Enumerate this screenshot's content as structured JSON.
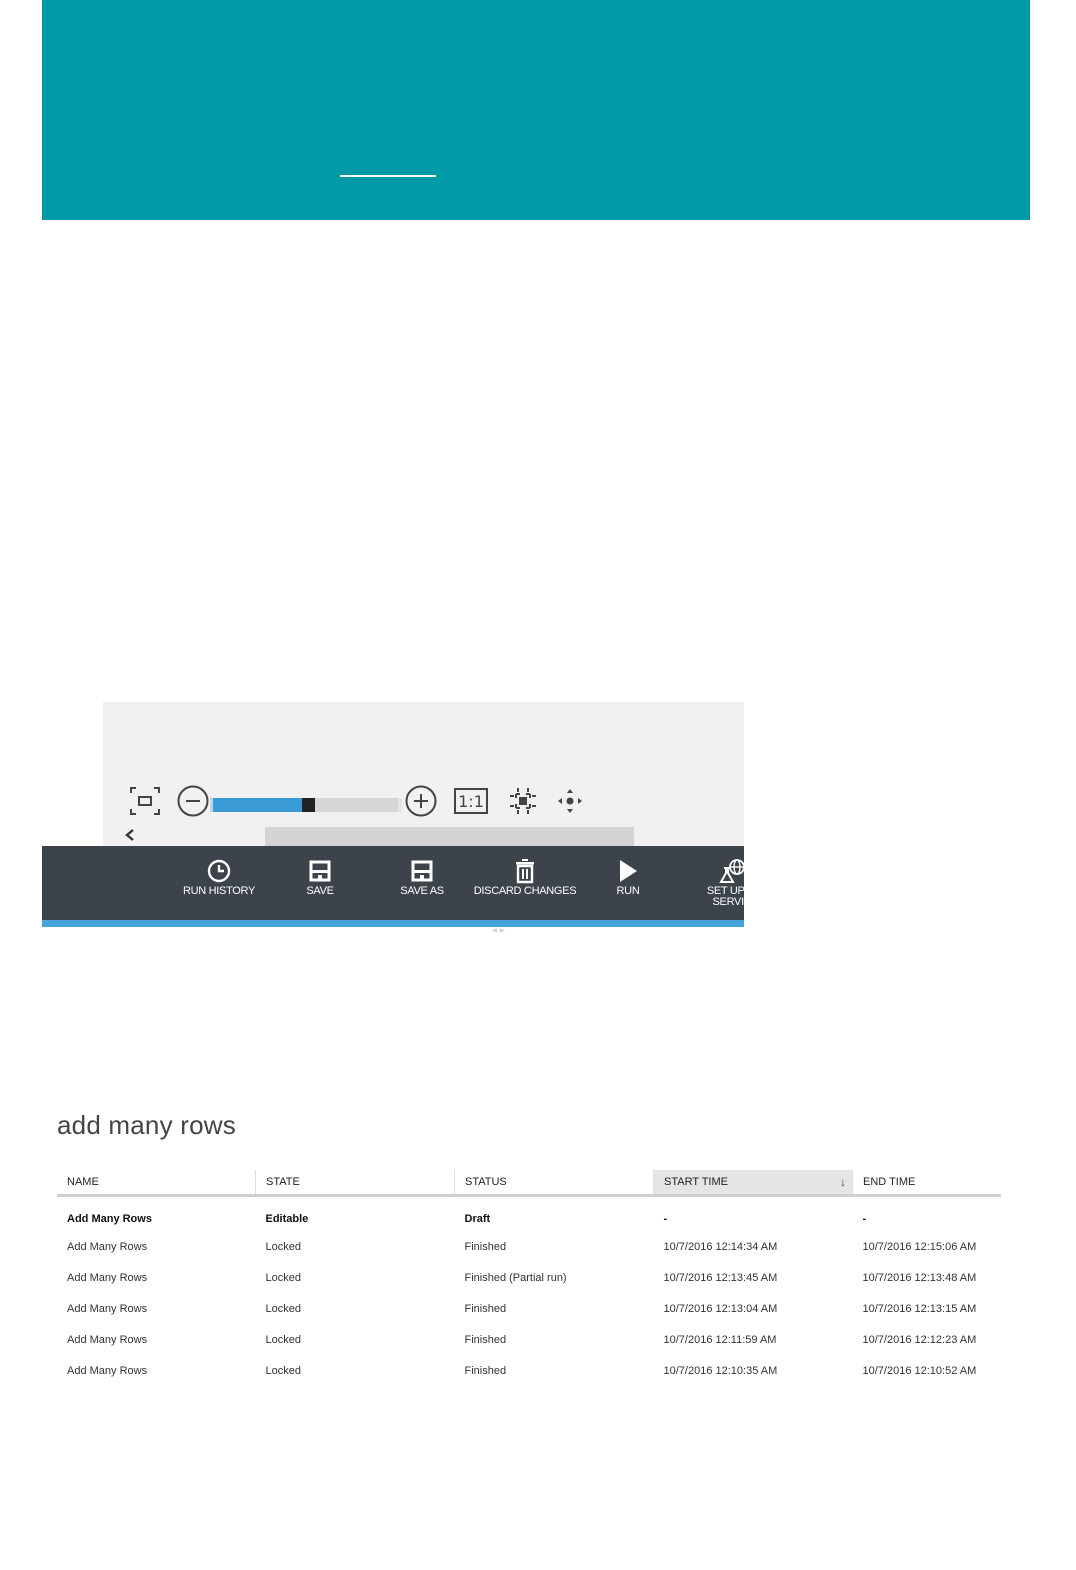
{
  "colors": {
    "banner": "#009ba6",
    "toolbar": "#3d434b",
    "accent": "#45a5d8",
    "slider_fill": "#3a9ad6"
  },
  "canvas_controls": {
    "icons": [
      "fit-to-screen-icon",
      "zoom-out-icon",
      "zoom-in-icon",
      "focus-icon",
      "pan-icon",
      "chevron-left-icon"
    ],
    "actual_size_label": "1:1",
    "zoom_fraction": 0.48
  },
  "toolbar": {
    "items": [
      {
        "label": "RUN HISTORY",
        "icon": "clock-icon"
      },
      {
        "label": "SAVE",
        "icon": "floppy-disk-icon"
      },
      {
        "label": "SAVE AS",
        "icon": "floppy-disk-icon"
      },
      {
        "label": "DISCARD CHANGES",
        "icon": "trash-icon"
      },
      {
        "label": "RUN",
        "icon": "play-icon"
      },
      {
        "label_line1": "SET UP W",
        "label_line2": "SERVIC",
        "icon": "flask-globe-icon"
      }
    ]
  },
  "runs": {
    "title": "add many rows",
    "columns": [
      "NAME",
      "STATE",
      "STATUS",
      "START TIME",
      "END TIME"
    ],
    "sorted_column": "START TIME",
    "rows": [
      {
        "name": "Add Many Rows",
        "state": "Editable",
        "status": "Draft",
        "start": "-",
        "end": "-"
      },
      {
        "name": "Add Many Rows",
        "state": "Locked",
        "status": "Finished",
        "start": "10/7/2016 12:14:34 AM",
        "end": "10/7/2016 12:15:06 AM"
      },
      {
        "name": "Add Many Rows",
        "state": "Locked",
        "status": "Finished (Partial run)",
        "start": "10/7/2016 12:13:45 AM",
        "end": "10/7/2016 12:13:48 AM"
      },
      {
        "name": "Add Many Rows",
        "state": "Locked",
        "status": "Finished",
        "start": "10/7/2016 12:13:04 AM",
        "end": "10/7/2016 12:13:15 AM"
      },
      {
        "name": "Add Many Rows",
        "state": "Locked",
        "status": "Finished",
        "start": "10/7/2016 12:11:59 AM",
        "end": "10/7/2016 12:12:23 AM"
      },
      {
        "name": "Add Many Rows",
        "state": "Locked",
        "status": "Finished",
        "start": "10/7/2016 12:10:35 AM",
        "end": "10/7/2016 12:10:52 AM"
      }
    ]
  }
}
